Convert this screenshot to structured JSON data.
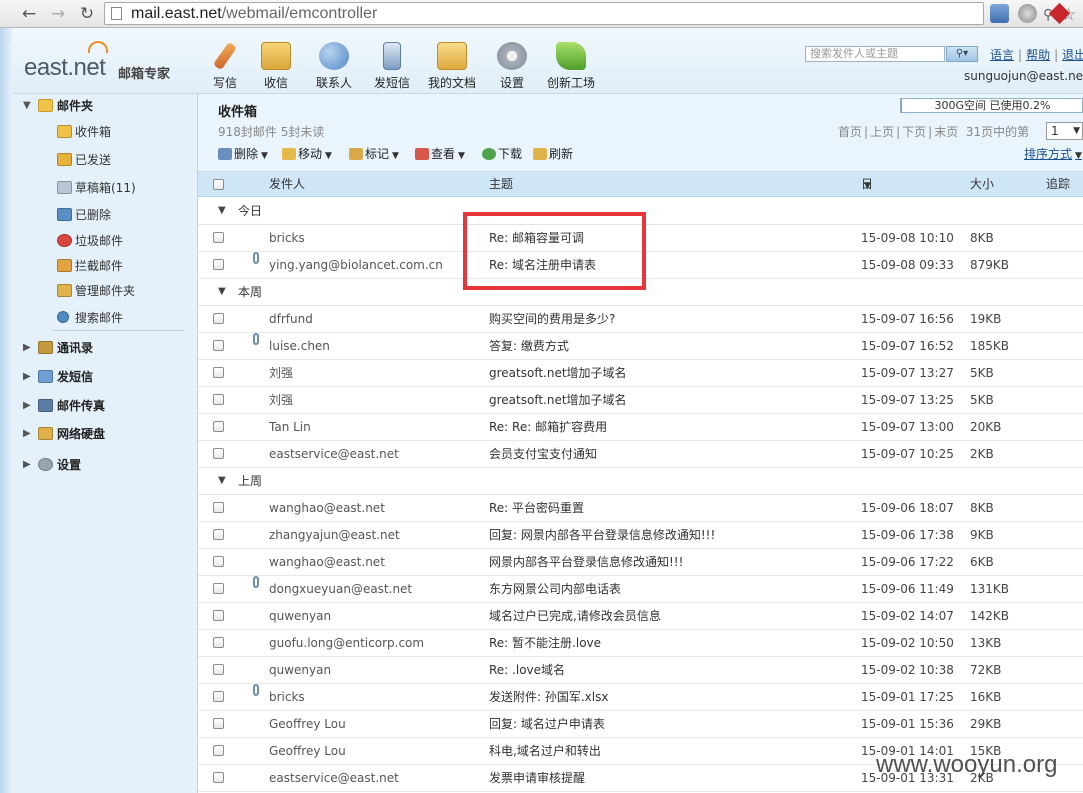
{
  "browser": {
    "url_host": "mail.east.net",
    "url_path": "/webmail/emcontroller"
  },
  "app": {
    "logo": "east.net",
    "logo_sub": "邮箱专家",
    "search_placeholder": "搜索发件人或主题",
    "links": {
      "language": "语言",
      "help": "帮助",
      "logout": "退出"
    },
    "user_email": "sunguojun@east.net"
  },
  "toolbar_main": [
    {
      "label": "写信",
      "color": "#e0863a"
    },
    {
      "label": "收信",
      "color": "#e8b94a"
    },
    {
      "label": "联系人",
      "color": "#6a9bd1"
    },
    {
      "label": "发短信",
      "color": "#7aa6d6"
    },
    {
      "label": "我的文档",
      "color": "#e3b44e"
    },
    {
      "label": "设置",
      "color": "#9aa4ae"
    },
    {
      "label": "创新工场",
      "color": "#78c040"
    }
  ],
  "sidebar": {
    "mail_folders": "邮件夹",
    "folders": [
      {
        "label": "收件箱",
        "color": "#f0c24a"
      },
      {
        "label": "已发送",
        "color": "#e8b23a"
      },
      {
        "label": "草稿箱(11)",
        "color": "#b8c6d4"
      },
      {
        "label": "已删除",
        "color": "#5a8fc6"
      },
      {
        "label": "垃圾邮件",
        "color": "#d9463e"
      },
      {
        "label": "拦截邮件",
        "color": "#e2a340"
      },
      {
        "label": "管理邮件夹",
        "color": "#e0b24a"
      },
      {
        "label": "搜索邮件",
        "color": "#4f8ac4"
      }
    ],
    "sections": [
      {
        "label": "通讯录",
        "color": "#c49a3e"
      },
      {
        "label": "发短信",
        "color": "#6d9fd4"
      },
      {
        "label": "邮件传真",
        "color": "#5c7ea6"
      },
      {
        "label": "网络硬盘",
        "color": "#e1b04a"
      },
      {
        "label": "设置",
        "color": "#9aa4ae"
      }
    ]
  },
  "main": {
    "title": "收件箱",
    "count": "918封邮件 5封未读",
    "quota": "300G空间 已使用0.2%",
    "quota_pct": 0.2,
    "pager": {
      "first": "首页",
      "prev": "上页",
      "next": "下页",
      "last": "末页",
      "info": "31页中的第",
      "page": "1"
    },
    "actions": {
      "delete": "删除",
      "move": "移动",
      "mark": "标记",
      "view": "查看",
      "download": "下载",
      "refresh": "刷新"
    },
    "sort": "排序方式",
    "columns": {
      "from": "发件人",
      "subject": "主题",
      "date": "日期",
      "size": "大小",
      "track": "追踪"
    }
  },
  "groups": [
    {
      "label": "今日",
      "mails": [
        {
          "from": "bricks",
          "subject": "Re: 邮箱容量可调",
          "date": "15-09-08 10:10",
          "size": "8KB",
          "attachment": false
        },
        {
          "from": "ying.yang@biolancet.com.cn",
          "subject": "Re: 域名注册申请表",
          "date": "15-09-08 09:33",
          "size": "879KB",
          "attachment": true
        }
      ]
    },
    {
      "label": "本周",
      "mails": [
        {
          "from": "dfrfund",
          "subject": "购买空间的费用是多少?",
          "date": "15-09-07 16:56",
          "size": "19KB",
          "attachment": false
        },
        {
          "from": "luise.chen",
          "subject": "答复: 缴费方式",
          "date": "15-09-07 16:52",
          "size": "185KB",
          "attachment": true
        },
        {
          "from": "刘强",
          "subject": "greatsoft.net增加子域名",
          "date": "15-09-07 13:27",
          "size": "5KB",
          "attachment": false
        },
        {
          "from": "刘强",
          "subject": "greatsoft.net增加子域名",
          "date": "15-09-07 13:25",
          "size": "5KB",
          "attachment": false
        },
        {
          "from": "Tan Lin",
          "subject": "Re: Re: 邮箱扩容费用",
          "date": "15-09-07 13:00",
          "size": "20KB",
          "attachment": false
        },
        {
          "from": "eastservice@east.net",
          "subject": "会员支付宝支付通知",
          "date": "15-09-07 10:25",
          "size": "2KB",
          "attachment": false
        }
      ]
    },
    {
      "label": "上周",
      "mails": [
        {
          "from": "wanghao@east.net",
          "subject": "Re: 平台密码重置",
          "date": "15-09-06 18:07",
          "size": "8KB",
          "attachment": false
        },
        {
          "from": "zhangyajun@east.net",
          "subject": "回复: 网景内部各平台登录信息修改通知!!!",
          "date": "15-09-06 17:38",
          "size": "9KB",
          "attachment": false
        },
        {
          "from": "wanghao@east.net",
          "subject": "网景内部各平台登录信息修改通知!!!",
          "date": "15-09-06 17:22",
          "size": "6KB",
          "attachment": false
        },
        {
          "from": "dongxueyuan@east.net",
          "subject": "东方网景公司内部电话表",
          "date": "15-09-06 11:49",
          "size": "131KB",
          "attachment": true
        },
        {
          "from": "quwenyan",
          "subject": "域名过户已完成,请修改会员信息",
          "date": "15-09-02 14:07",
          "size": "142KB",
          "attachment": false
        },
        {
          "from": "guofu.long@enticorp.com",
          "subject": "Re: 暂不能注册.love",
          "date": "15-09-02 10:50",
          "size": "13KB",
          "attachment": false
        },
        {
          "from": "quwenyan",
          "subject": "Re: .love域名",
          "date": "15-09-02 10:38",
          "size": "72KB",
          "attachment": false
        },
        {
          "from": "bricks",
          "subject": "发送附件: 孙国军.xlsx",
          "date": "15-09-01 17:25",
          "size": "16KB",
          "attachment": true
        },
        {
          "from": "Geoffrey Lou",
          "subject": "回复: 域名过户申请表",
          "date": "15-09-01 15:36",
          "size": "29KB",
          "attachment": false
        },
        {
          "from": "Geoffrey Lou",
          "subject": "科电,域名过户和转出",
          "date": "15-09-01 14:01",
          "size": "15KB",
          "attachment": false
        },
        {
          "from": "eastservice@east.net",
          "subject": "发票申请审核提醒",
          "date": "15-09-01 13:31",
          "size": "2KB",
          "attachment": false
        }
      ]
    }
  ],
  "watermark": "www.wooyun.org"
}
